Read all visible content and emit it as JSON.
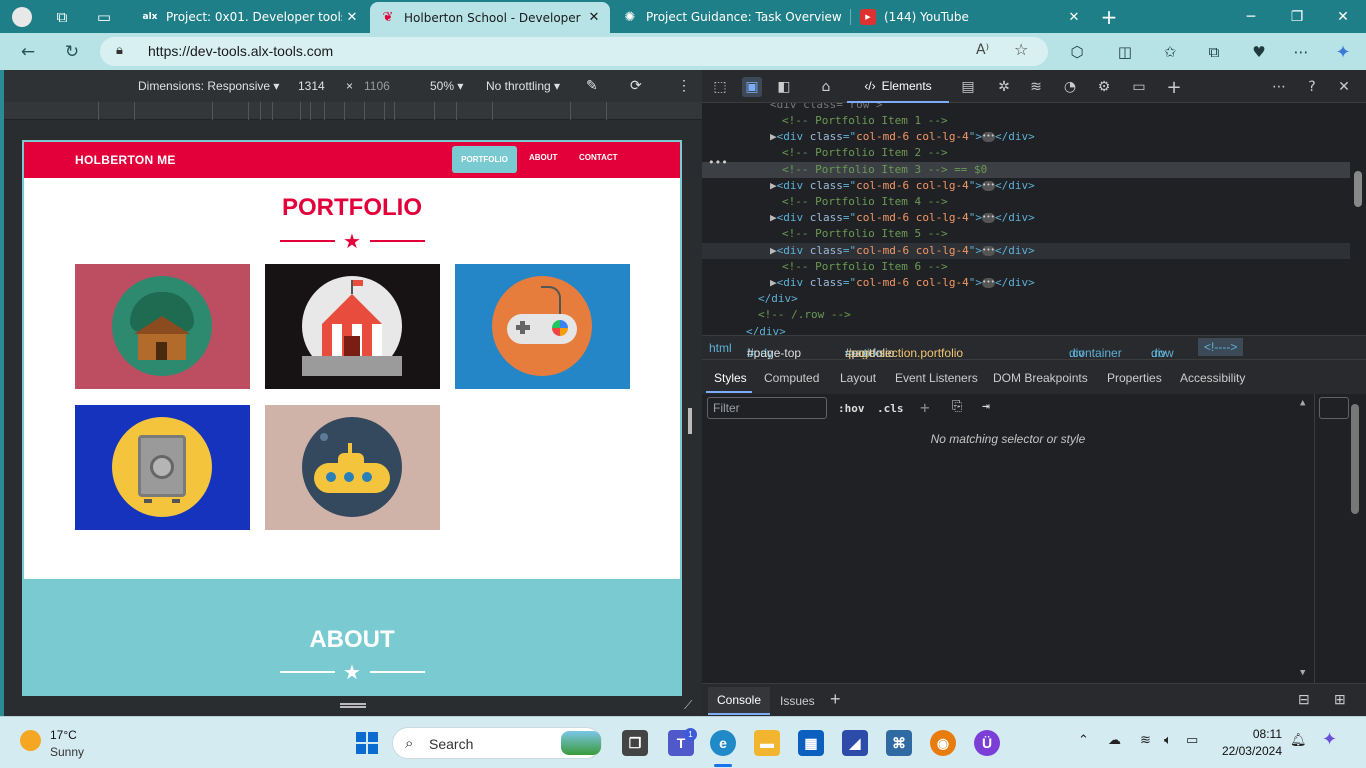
{
  "browser": {
    "tabs": [
      {
        "label": "Project: 0x01. Developer tools | N",
        "favicon": "alx"
      },
      {
        "label": "Holberton School - Developer to",
        "favicon": "h"
      },
      {
        "label": "Project Guidance: Task Overview",
        "favicon": "o"
      },
      {
        "label": "(144) YouTube",
        "favicon": "yt"
      }
    ],
    "url": "https://dev-tools.alx-tools.com"
  },
  "device_toolbar": {
    "dimensions": "Dimensions: Responsive ▾",
    "width": "1314",
    "times": "×",
    "height": "1106",
    "zoom": "50% ▾",
    "throttling": "No throttling ▾"
  },
  "site": {
    "brand": "HOLBERTON ME",
    "nav": [
      "PORTFOLIO",
      "ABOUT",
      "CONTACT"
    ],
    "portfolio_title": "PORTFOLIO",
    "about_title": "ABOUT",
    "star": "★",
    "items": [
      {
        "bg": "#bd4e62",
        "circ": "#2e8a6e",
        "icon": "cabin-icon"
      },
      {
        "bg": "#171314",
        "circ": "#e8e8e8",
        "icon": "circus-tent-icon"
      },
      {
        "bg": "#2485c7",
        "circ": "#e77d3c",
        "icon": "game-controller-icon"
      },
      {
        "bg": "#1533bd",
        "circ": "#f4c43c",
        "icon": "safe-icon"
      },
      {
        "bg": "#cfb3a8",
        "circ": "#34495e",
        "icon": "submarine-icon"
      }
    ],
    "colors": {
      "primary": "#e3003a",
      "accent": "#79cbd1"
    }
  },
  "devtools": {
    "elements_tab": "Elements",
    "dom_lines": [
      {
        "cls": "",
        "indent": 6,
        "text": "<!-- Portfolio Item 1 -->",
        "kind": "comment"
      },
      {
        "cls": "",
        "indent": 5,
        "text": "col-md-6 col-lg-4",
        "kind": "div"
      },
      {
        "cls": "",
        "indent": 6,
        "text": "<!-- Portfolio Item 2 -->",
        "kind": "comment"
      },
      {
        "cls": "sel",
        "indent": 6,
        "text": "<!-- Portfolio Item 3 --> == $0",
        "kind": "comment"
      },
      {
        "cls": "",
        "indent": 5,
        "text": "col-md-6 col-lg-4",
        "kind": "div"
      },
      {
        "cls": "",
        "indent": 6,
        "text": "<!-- Portfolio Item 4 -->",
        "kind": "comment"
      },
      {
        "cls": "",
        "indent": 5,
        "text": "col-md-6 col-lg-4",
        "kind": "div"
      },
      {
        "cls": "",
        "indent": 6,
        "text": "<!-- Portfolio Item 5 -->",
        "kind": "comment"
      },
      {
        "cls": "hov",
        "indent": 5,
        "text": "col-md-6 col-lg-4",
        "kind": "div"
      },
      {
        "cls": "",
        "indent": 6,
        "text": "<!-- Portfolio Item 6 -->",
        "kind": "comment"
      },
      {
        "cls": "",
        "indent": 5,
        "text": "col-md-6 col-lg-4",
        "kind": "div"
      },
      {
        "cls": "",
        "indent": 4,
        "text": "</div>",
        "kind": "closetag"
      },
      {
        "cls": "",
        "indent": 4,
        "text": "<!-- /.row -->",
        "kind": "comment"
      },
      {
        "cls": "",
        "indent": 3,
        "text": "</div>",
        "kind": "closetag"
      }
    ],
    "breadcrumbs": [
      {
        "tag": "html",
        "rest": ""
      },
      {
        "tag": "body",
        "rest": "#page-top"
      },
      {
        "tag": "section",
        "rest": "#portfolio",
        "cls": ".page-section.portfolio"
      },
      {
        "tag": "div",
        "rest": ".container"
      },
      {
        "tag": "div",
        "rest": ".row"
      },
      {
        "tag": "<!---->",
        "rest": ""
      }
    ],
    "subtabs": [
      "Styles",
      "Computed",
      "Layout",
      "Event Listeners",
      "DOM Breakpoints",
      "Properties",
      "Accessibility"
    ],
    "filter_placeholder": "Filter",
    "hov": ":hov",
    "cls": ".cls",
    "no_match": "No matching selector or style",
    "drawer": [
      "Console",
      "Issues"
    ]
  },
  "taskbar": {
    "weather_temp": "17°C",
    "weather_cond": "Sunny",
    "search": "Search",
    "time": "08:11",
    "date": "22/03/2024",
    "teams_badge": "1"
  }
}
